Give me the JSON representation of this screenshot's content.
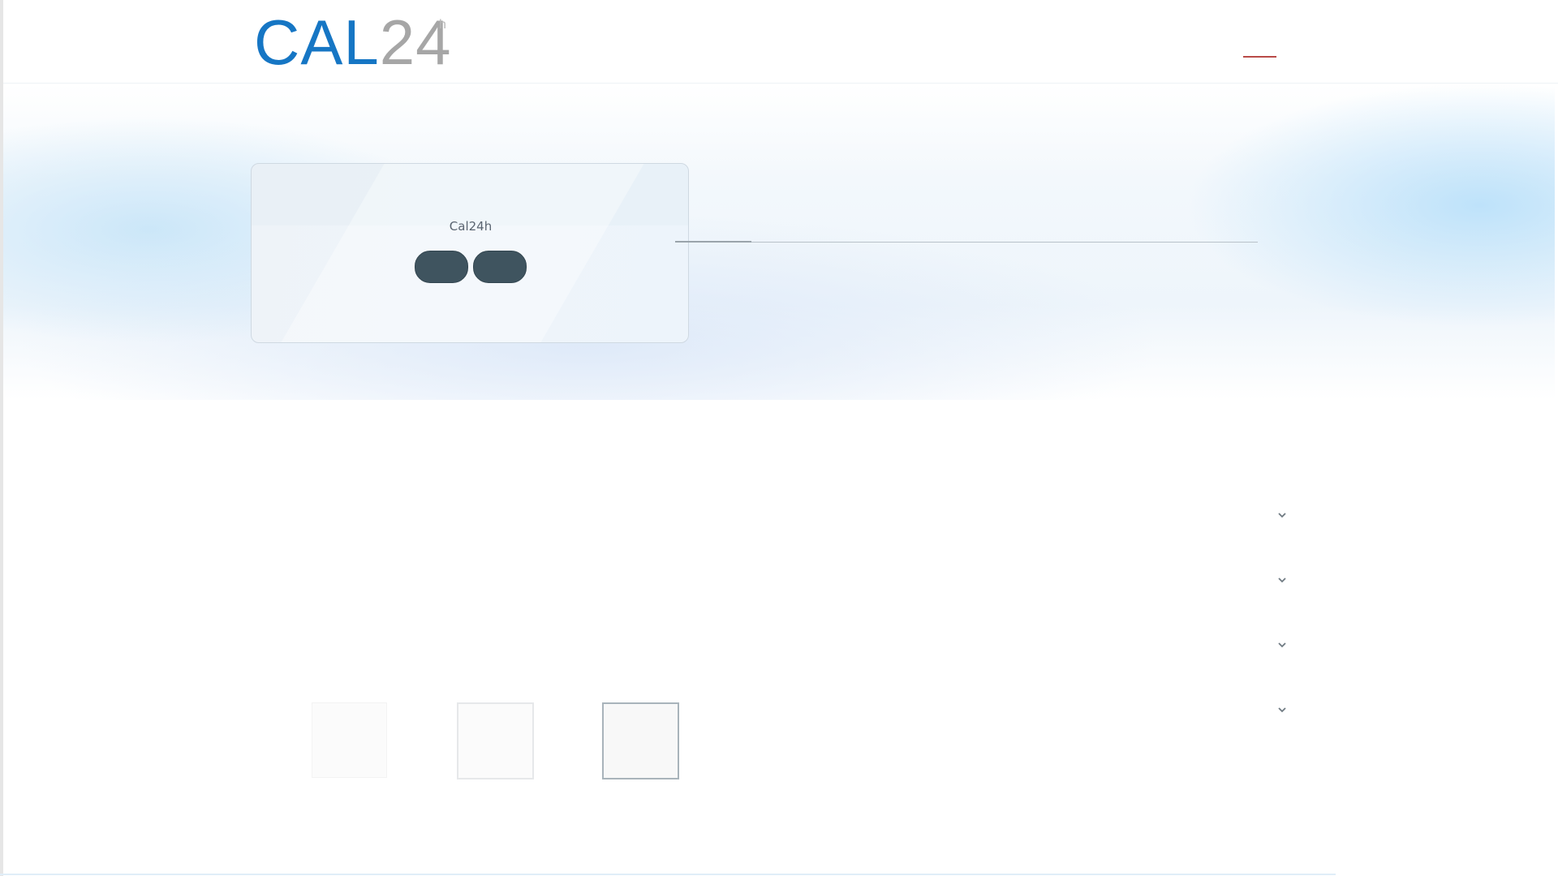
{
  "header": {
    "logo": {
      "main": "CAL",
      "number": "24",
      "superscript": "h"
    }
  },
  "hero": {
    "panel_title": "Cal24h"
  },
  "accordion": {
    "items": [
      {
        "label": ""
      },
      {
        "label": ""
      },
      {
        "label": ""
      },
      {
        "label": ""
      }
    ]
  },
  "thumbnails": {
    "count": 3,
    "active_index": 3
  },
  "colors": {
    "brand_blue": "#1676c4",
    "logo_gray": "#a6a6a6",
    "menu_accent": "#b94a48",
    "button_dark": "#3f545f"
  },
  "icons": {
    "menu": "menu-toggle-icon",
    "chevron": "chevron-down-icon"
  }
}
